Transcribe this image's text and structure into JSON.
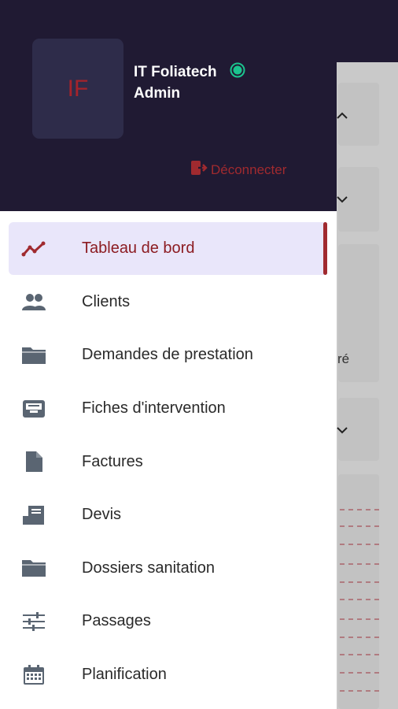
{
  "user": {
    "initials": "IF",
    "name": "IT Foliatech",
    "role": "Admin",
    "status_color": "#1bc48e"
  },
  "logout": {
    "label": "Déconnecter"
  },
  "menu": {
    "items": [
      {
        "label": "Tableau de bord",
        "icon": "chart-line-icon",
        "active": true
      },
      {
        "label": "Clients",
        "icon": "users-icon"
      },
      {
        "label": "Demandes de prestation",
        "icon": "folder-icon"
      },
      {
        "label": "Fiches d'intervention",
        "icon": "inbox-icon"
      },
      {
        "label": "Factures",
        "icon": "document-icon"
      },
      {
        "label": "Devis",
        "icon": "receipt-icon"
      },
      {
        "label": "Dossiers sanitation",
        "icon": "folder-icon"
      },
      {
        "label": "Passages",
        "icon": "sliders-icon"
      },
      {
        "label": "Planification",
        "icon": "calendar-icon"
      }
    ]
  },
  "background": {
    "snippet": "ré"
  },
  "colors": {
    "accent": "#a02a2f",
    "header_bg": "#201a33",
    "active_bg": "#e9e6fa"
  }
}
